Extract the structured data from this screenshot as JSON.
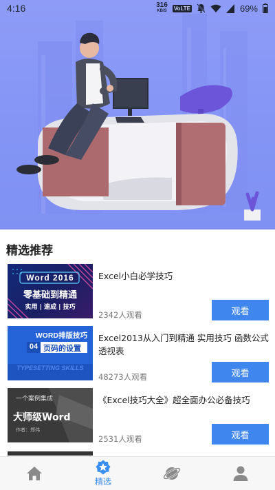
{
  "status_bar": {
    "time": "4:16",
    "net_speed": "316",
    "net_unit": "KB/S",
    "volte": "VoLTE",
    "battery": "69%"
  },
  "section": {
    "title": "精选推荐"
  },
  "courses": [
    {
      "title": "Excel小白必学技巧",
      "views": "2342人观看",
      "button": "观看",
      "thumb": {
        "line1": "Word 2016",
        "line2": "零基础到精通",
        "line3": "实用 | 速成 | 技巧"
      }
    },
    {
      "title": "Excel2013从入门到精通 实用技巧 函数公式透视表",
      "views": "48273人观看",
      "button": "观看",
      "thumb": {
        "line1": "WORD排版技巧",
        "num": "04",
        "line2": "页码的设置",
        "line3": "TYPESETTING SKILLS"
      }
    },
    {
      "title": "《Excel技巧大全》超全面办公必备技巧",
      "views": "2531人观看",
      "button": "观看",
      "thumb": {
        "line1": "一个案例集成",
        "line2": "大师级Word",
        "line3": "作者：郑伟"
      }
    }
  ],
  "bottom_nav": {
    "items": [
      {
        "icon": "home-icon",
        "label": ""
      },
      {
        "icon": "star-badge-icon",
        "label": "精选"
      },
      {
        "icon": "planet-icon",
        "label": ""
      },
      {
        "icon": "user-icon",
        "label": ""
      }
    ]
  },
  "colors": {
    "hero_bg": "#8394f5",
    "accent": "#3f87ef",
    "nav_active": "#3a8ef0",
    "nav_inactive": "#8a8a8a"
  }
}
